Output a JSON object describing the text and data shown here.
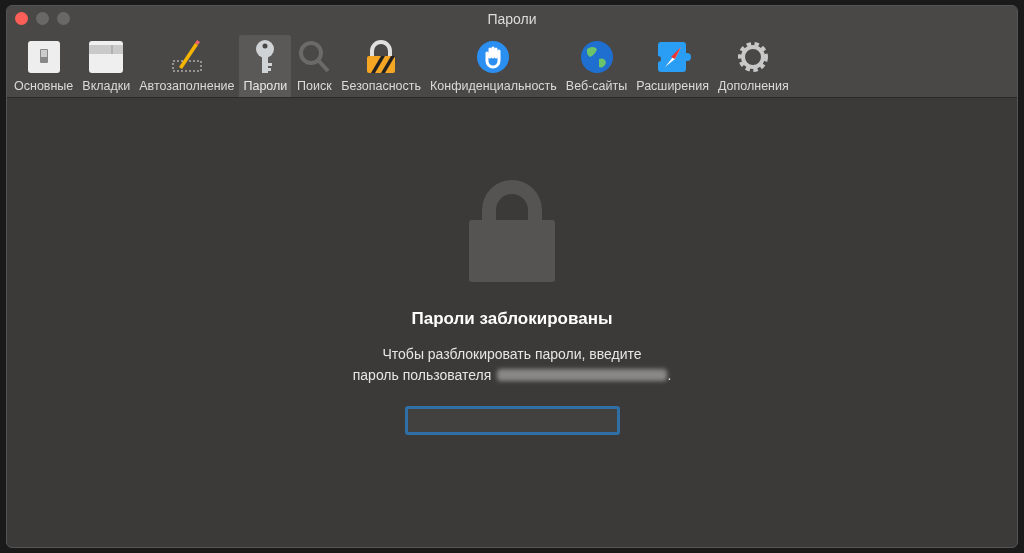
{
  "window": {
    "title": "Пароли"
  },
  "tabs": [
    {
      "label": "Основные",
      "selected": false
    },
    {
      "label": "Вкладки",
      "selected": false
    },
    {
      "label": "Автозаполнение",
      "selected": false
    },
    {
      "label": "Пароли",
      "selected": true
    },
    {
      "label": "Поиск",
      "selected": false
    },
    {
      "label": "Безопасность",
      "selected": false
    },
    {
      "label": "Конфиденциальность",
      "selected": false
    },
    {
      "label": "Веб-сайты",
      "selected": false
    },
    {
      "label": "Расширения",
      "selected": false
    },
    {
      "label": "Дополнения",
      "selected": false
    }
  ],
  "locked_panel": {
    "heading": "Пароли заблокированы",
    "message_line_1": "Чтобы разблокировать пароли, введите",
    "message_line_2": "пароль пользователя",
    "message_end": "."
  }
}
